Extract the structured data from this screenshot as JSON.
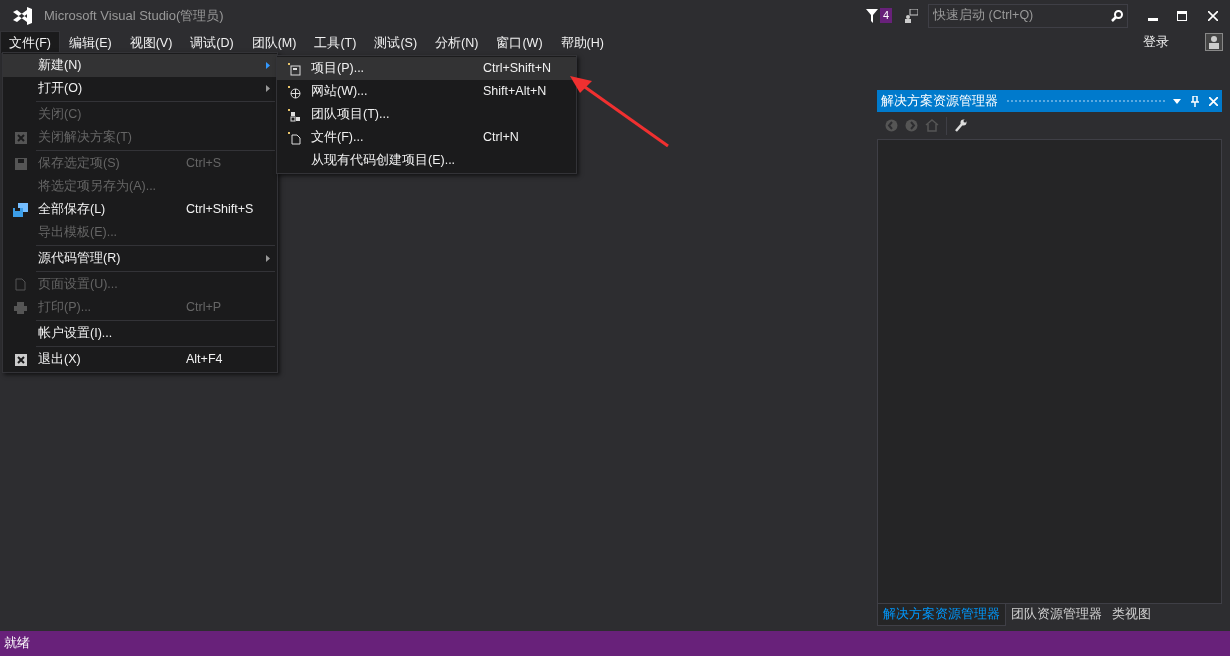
{
  "window": {
    "title": "Microsoft Visual Studio(管理员)",
    "notification_count": "4",
    "quick_launch": {
      "placeholder": "快速启动 (Ctrl+Q)"
    },
    "sign_in": "登录"
  },
  "menu_bar": [
    {
      "label": "文件(F)",
      "selected": true
    },
    {
      "label": "编辑(E)",
      "selected": false
    },
    {
      "label": "视图(V)",
      "selected": false
    },
    {
      "label": "调试(D)",
      "selected": false
    },
    {
      "label": "团队(M)",
      "selected": false
    },
    {
      "label": "工具(T)",
      "selected": false
    },
    {
      "label": "测试(S)",
      "selected": false
    },
    {
      "label": "分析(N)",
      "selected": false
    },
    {
      "label": "窗口(W)",
      "selected": false
    },
    {
      "label": "帮助(H)",
      "selected": false
    }
  ],
  "file_menu": [
    {
      "kind": "item",
      "label": "新建(N)",
      "submenu": true,
      "selected": true,
      "disabled": false
    },
    {
      "kind": "item",
      "label": "打开(O)",
      "submenu": true,
      "selected": false,
      "disabled": false
    },
    {
      "kind": "separator"
    },
    {
      "kind": "item",
      "label": "关闭(C)",
      "selected": false,
      "disabled": true
    },
    {
      "kind": "item",
      "label": "关闭解决方案(T)",
      "selected": false,
      "disabled": true
    },
    {
      "kind": "separator"
    },
    {
      "kind": "item",
      "label": "保存选定项(S)",
      "shortcut": "Ctrl+S",
      "selected": false,
      "disabled": true
    },
    {
      "kind": "item",
      "label": "将选定项另存为(A)...",
      "selected": false,
      "disabled": true
    },
    {
      "kind": "item",
      "label": "全部保存(L)",
      "shortcut": "Ctrl+Shift+S",
      "selected": false,
      "disabled": false
    },
    {
      "kind": "item",
      "label": "导出模板(E)...",
      "selected": false,
      "disabled": true
    },
    {
      "kind": "separator"
    },
    {
      "kind": "item",
      "label": "源代码管理(R)",
      "submenu": true,
      "selected": false,
      "disabled": false
    },
    {
      "kind": "separator"
    },
    {
      "kind": "item",
      "label": "页面设置(U)...",
      "selected": false,
      "disabled": true
    },
    {
      "kind": "item",
      "label": "打印(P)...",
      "shortcut": "Ctrl+P",
      "selected": false,
      "disabled": true
    },
    {
      "kind": "separator"
    },
    {
      "kind": "item",
      "label": "帐户设置(I)...",
      "selected": false,
      "disabled": false
    },
    {
      "kind": "separator"
    },
    {
      "kind": "item",
      "label": "退出(X)",
      "shortcut": "Alt+F4",
      "selected": false,
      "disabled": false
    }
  ],
  "new_submenu": [
    {
      "label": "项目(P)...",
      "shortcut": "Ctrl+Shift+N",
      "selected": true
    },
    {
      "label": "网站(W)...",
      "shortcut": "Shift+Alt+N",
      "selected": false
    },
    {
      "label": "团队项目(T)...",
      "selected": false
    },
    {
      "label": "文件(F)...",
      "shortcut": "Ctrl+N",
      "selected": false
    },
    {
      "label": "从现有代码创建项目(E)...",
      "selected": false
    }
  ],
  "solution_explorer": {
    "title": "解决方案资源管理器",
    "tabs": [
      {
        "label": "解决方案资源管理器",
        "selected": true
      },
      {
        "label": "团队资源管理器",
        "selected": false
      },
      {
        "label": "类视图",
        "selected": false
      }
    ]
  },
  "status_bar": {
    "text": "就绪"
  }
}
